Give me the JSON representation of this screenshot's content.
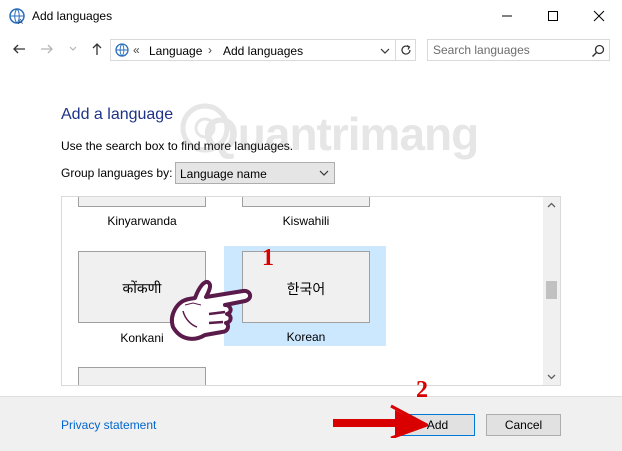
{
  "window": {
    "title": "Add languages",
    "controls": {
      "minimize": "minimize",
      "maximize": "maximize",
      "close": "close"
    }
  },
  "nav": {
    "breadcrumb_sep": "«",
    "breadcrumbs": [
      "Language",
      "Add languages"
    ],
    "crumb_chevron": "›",
    "search_placeholder": "Search languages"
  },
  "main": {
    "heading": "Add a language",
    "instructions": "Use the search box to find more languages.",
    "group_label": "Group languages by:",
    "group_value": "Language name"
  },
  "languages": [
    {
      "name": "Kinyarwanda",
      "script": ""
    },
    {
      "name": "Kiswahili",
      "script": ""
    },
    {
      "name": "Konkani",
      "script": "कोंकणी"
    },
    {
      "name": "Korean",
      "script": "한국어",
      "selected": true
    }
  ],
  "footer": {
    "privacy": "Privacy statement",
    "add": "Add",
    "cancel": "Cancel"
  },
  "annotations": {
    "step1": "1",
    "step2": "2",
    "watermark": "Quantrimang"
  },
  "colors": {
    "heading": "#1e3287",
    "link": "#0066cc",
    "selection": "#cce8ff",
    "annotation_red": "#d80000",
    "footer_bg": "#f0f0f0"
  }
}
